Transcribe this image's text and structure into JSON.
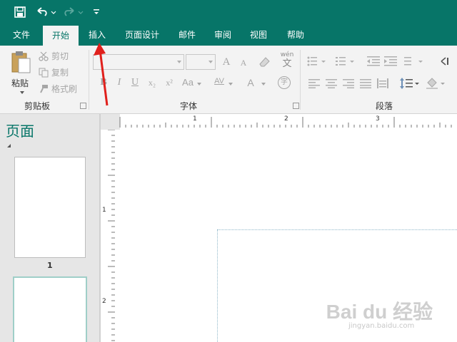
{
  "quick_access": {
    "save_icon": "save-icon",
    "undo_icon": "undo-icon",
    "redo_icon": "redo-icon",
    "customize_icon": "customize-qat-icon"
  },
  "tabs": [
    {
      "label": "文件"
    },
    {
      "label": "开始",
      "active": true
    },
    {
      "label": "插入"
    },
    {
      "label": "页面设计"
    },
    {
      "label": "邮件"
    },
    {
      "label": "审阅"
    },
    {
      "label": "视图"
    },
    {
      "label": "帮助"
    }
  ],
  "ribbon": {
    "clipboard": {
      "paste_label": "粘贴",
      "cut_label": "剪切",
      "copy_label": "复制",
      "format_painter_label": "格式刷",
      "group_label": "剪贴板"
    },
    "font": {
      "group_label": "字体",
      "bold": "B",
      "italic": "I",
      "underline": "U",
      "subscript": "x₂",
      "superscript": "x²",
      "change_case": "Aa",
      "char_spacing": "AV",
      "font_color": "A",
      "grow_font": "A",
      "shrink_font": "A",
      "phonetic": "wén",
      "phonetic_char": "文",
      "enclose_char": "字"
    },
    "paragraph": {
      "group_label": "段落"
    }
  },
  "pages_panel": {
    "title": "页面",
    "pages": [
      {
        "number": "1"
      },
      {
        "number": "2"
      }
    ]
  },
  "ruler": {
    "h_labels": [
      "1",
      "2",
      "3"
    ],
    "v_labels": [
      "1",
      "2"
    ]
  },
  "watermark": {
    "text": "Bai du 经验",
    "url": "jingyan.baidu.com"
  },
  "colors": {
    "accent": "#077568",
    "annotation": "#e0201c"
  }
}
